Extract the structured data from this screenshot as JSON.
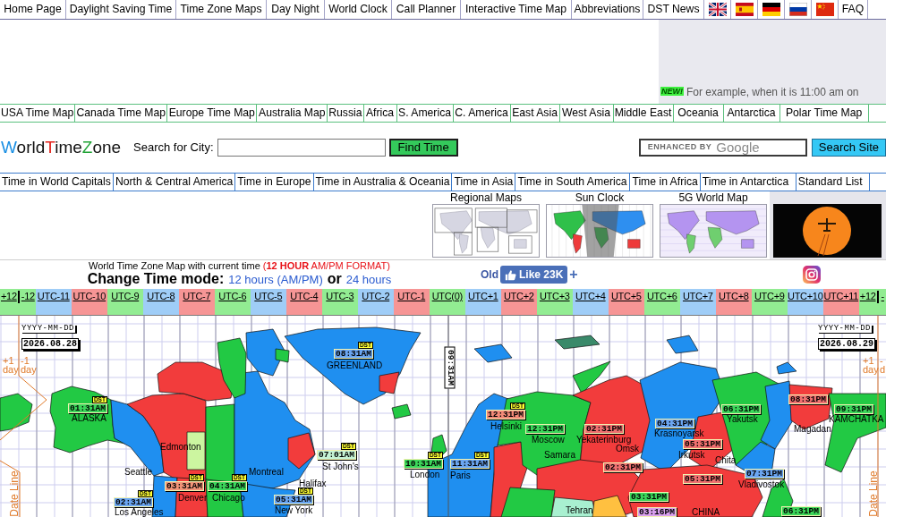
{
  "top_nav": {
    "links_before_flags": [
      "Home Page",
      "Daylight Saving Time",
      "Time Zone Maps",
      "Day Night",
      "World Clock",
      "Call Planner",
      "Interactive Time Map",
      "Abbreviations",
      "DST News"
    ],
    "links_after_flags": [
      "FAQ"
    ]
  },
  "ad_panel": {
    "badge": "NEW!",
    "text": "For example, when it is 11:00 am on"
  },
  "region_nav": [
    "USA Time Map",
    "Canada Time Map",
    "Europe Time Map",
    "Australia Map",
    "Russia",
    "Africa",
    "S. America",
    "C. America",
    "East Asia",
    "West Asia",
    "Middle East",
    "Oceania",
    "Antarctica",
    "Polar Time Map"
  ],
  "search": {
    "logo": [
      {
        "text": "W",
        "color": "#1a8fe3"
      },
      {
        "text": "orld",
        "color": "#111111"
      },
      {
        "text": "T",
        "color": "#e3221b"
      },
      {
        "text": "ime",
        "color": "#111111"
      },
      {
        "text": "Z",
        "color": "#21a336"
      },
      {
        "text": "one",
        "color": "#111111"
      }
    ],
    "label": "Search for City:",
    "button": "Find Time"
  },
  "site_search": {
    "branding_prefix": "ENHANCED BY",
    "branding_name": "Google",
    "button": "Search Site"
  },
  "time_nav": [
    "Time in World Capitals",
    "North & Central America",
    "Time in Europe",
    "Time in Australia & Oceania",
    "Time in Asia",
    "Time in South America",
    "Time in Africa",
    "Time in Antarctica",
    "Standard List"
  ],
  "thumbnails": [
    {
      "caption": "Regional Maps",
      "kind": "regions"
    },
    {
      "caption": "Sun Clock",
      "kind": "sun"
    },
    {
      "caption": "5G World Map",
      "kind": "zones"
    }
  ],
  "map_header": {
    "title": "World Time Zone Map with current time",
    "format": "(**12 HOUR** AM/PM FORMAT)",
    "mode_label": "Change Time mode:",
    "mode_options": [
      "12 hours (AM/PM)",
      "24 hours"
    ],
    "separator": "or"
  },
  "social": {
    "old_label": "Old",
    "like_button": "Like 23K",
    "plus": "+"
  },
  "utc_zones": [
    {
      "label": "+12",
      "kind": "dateline",
      "color": "#92ec92"
    },
    {
      "label": "-12",
      "kind": "dateline",
      "color": "#92ec92"
    },
    {
      "label": "UTC-11",
      "kind": "zone",
      "color": "#9fcdf7"
    },
    {
      "label": "UTC-10",
      "kind": "zone",
      "color": "#f69595"
    },
    {
      "label": "UTC-9",
      "kind": "zone",
      "color": "#92ec92"
    },
    {
      "label": "UTC-8",
      "kind": "zone",
      "color": "#9fcdf7"
    },
    {
      "label": "UTC-7",
      "kind": "zone",
      "color": "#f69595"
    },
    {
      "label": "UTC-6",
      "kind": "zone",
      "color": "#92ec92"
    },
    {
      "label": "UTC-5",
      "kind": "zone",
      "color": "#9fcdf7"
    },
    {
      "label": "UTC-4",
      "kind": "zone",
      "color": "#f69595"
    },
    {
      "label": "UTC-3",
      "kind": "zone",
      "color": "#92ec92"
    },
    {
      "label": "UTC-2",
      "kind": "zone",
      "color": "#9fcdf7"
    },
    {
      "label": "UTC-1",
      "kind": "zone",
      "color": "#f69595"
    },
    {
      "label": "UTC(0)",
      "kind": "zone",
      "color": "#92ec92"
    },
    {
      "label": "UTC+1",
      "kind": "zone",
      "color": "#9fcdf7"
    },
    {
      "label": "UTC+2",
      "kind": "zone",
      "color": "#f69595"
    },
    {
      "label": "UTC+3",
      "kind": "zone",
      "color": "#92ec92"
    },
    {
      "label": "UTC+4",
      "kind": "zone",
      "color": "#9fcdf7"
    },
    {
      "label": "UTC+5",
      "kind": "zone",
      "color": "#f69595"
    },
    {
      "label": "UTC+6",
      "kind": "zone",
      "color": "#92ec92"
    },
    {
      "label": "UTC+7",
      "kind": "zone",
      "color": "#9fcdf7"
    },
    {
      "label": "UTC+8",
      "kind": "zone",
      "color": "#f69595"
    },
    {
      "label": "UTC+9",
      "kind": "zone",
      "color": "#92ec92"
    },
    {
      "label": "UTC+10",
      "kind": "zone",
      "color": "#9fcdf7"
    },
    {
      "label": "UTC+11",
      "kind": "zone",
      "color": "#f69595"
    },
    {
      "label": "+12",
      "kind": "dateline",
      "color": "#92ec92"
    },
    {
      "label": "-",
      "kind": "dateline",
      "color": "#92ec92"
    }
  ],
  "map": {
    "date_panels": [
      {
        "format": "YYYY-MM-DD",
        "date": "2026.08.28"
      },
      {
        "format": "YYYY-MM-DD",
        "date": "2026.08.29"
      }
    ],
    "day_shifts": [
      {
        "sign": "+1",
        "unit": "day"
      },
      {
        "sign": "-1",
        "unit": "day"
      },
      {
        "sign": "+1",
        "unit": "day"
      },
      {
        "sign": "-",
        "unit": "d"
      }
    ],
    "date_line_labels": [
      "Date Line",
      "Date Line"
    ],
    "utc_clock": "09:31AM",
    "clocks": [
      {
        "time": "08:31AM",
        "badge": "DST",
        "color": "#6ba6f2"
      },
      {
        "time": "08:31PM",
        "color": "#f07070"
      },
      {
        "time": "01:31AM",
        "badge": "DST",
        "color": "#3bd65a"
      },
      {
        "time": "12:31PM",
        "badge": "DST",
        "color": "#f28a78"
      },
      {
        "time": "06:31PM",
        "color": "#3bd65a"
      },
      {
        "time": "09:31PM",
        "color": "#3bd65a"
      },
      {
        "time": "12:31PM",
        "color": "#3bd65a"
      },
      {
        "time": "02:31PM",
        "color": "#f07070"
      },
      {
        "time": "04:31PM",
        "color": "#6ba6f2"
      },
      {
        "time": "05:31PM",
        "color": "#f07070"
      },
      {
        "time": "07:01AM",
        "badge": "DST",
        "color": "#c5f3d5"
      },
      {
        "time": "10:31AM",
        "badge": "DST",
        "color": "#3bd65a"
      },
      {
        "time": "11:31AM",
        "badge": "DST",
        "color": "#6ba6f2"
      },
      {
        "time": "02:31PM",
        "color": "#f07070"
      },
      {
        "time": "05:31PM",
        "color": "#f07070"
      },
      {
        "time": "07:31PM",
        "color": "#6ba6f2"
      },
      {
        "time": "03:31AM",
        "badge": "DST",
        "color": "#f29478"
      },
      {
        "time": "04:31AM",
        "badge": "DST",
        "color": "#3bd65a"
      },
      {
        "time": "02:31AM",
        "badge": "DST",
        "color": "#6ba6f2"
      },
      {
        "time": "05:31AM",
        "badge": "DST",
        "color": "#6ba6f2"
      },
      {
        "time": "03:31PM",
        "color": "#3bd65a"
      },
      {
        "time": "03:16PM",
        "color": "#d9a0ee"
      },
      {
        "time": "06:31PM",
        "color": "#3bd65a"
      }
    ],
    "places": [
      "GREENLAND",
      "ALASKA",
      "Yakutsk",
      "KAMCHATKA",
      "Helsinki",
      "Krasnoyarsk",
      "Magadan",
      "Moscow",
      "Yekaterinburg",
      "Edmonton",
      "Omsk",
      "Samara",
      "Irkutsk",
      "Chita",
      "Seattle",
      "Montreal",
      "St John's",
      "London",
      "Paris",
      "Halifax",
      "Vladivostok",
      "Denver",
      "Chicago",
      "Los Angeles",
      "New York",
      "Tehran",
      "CHINA"
    ]
  }
}
